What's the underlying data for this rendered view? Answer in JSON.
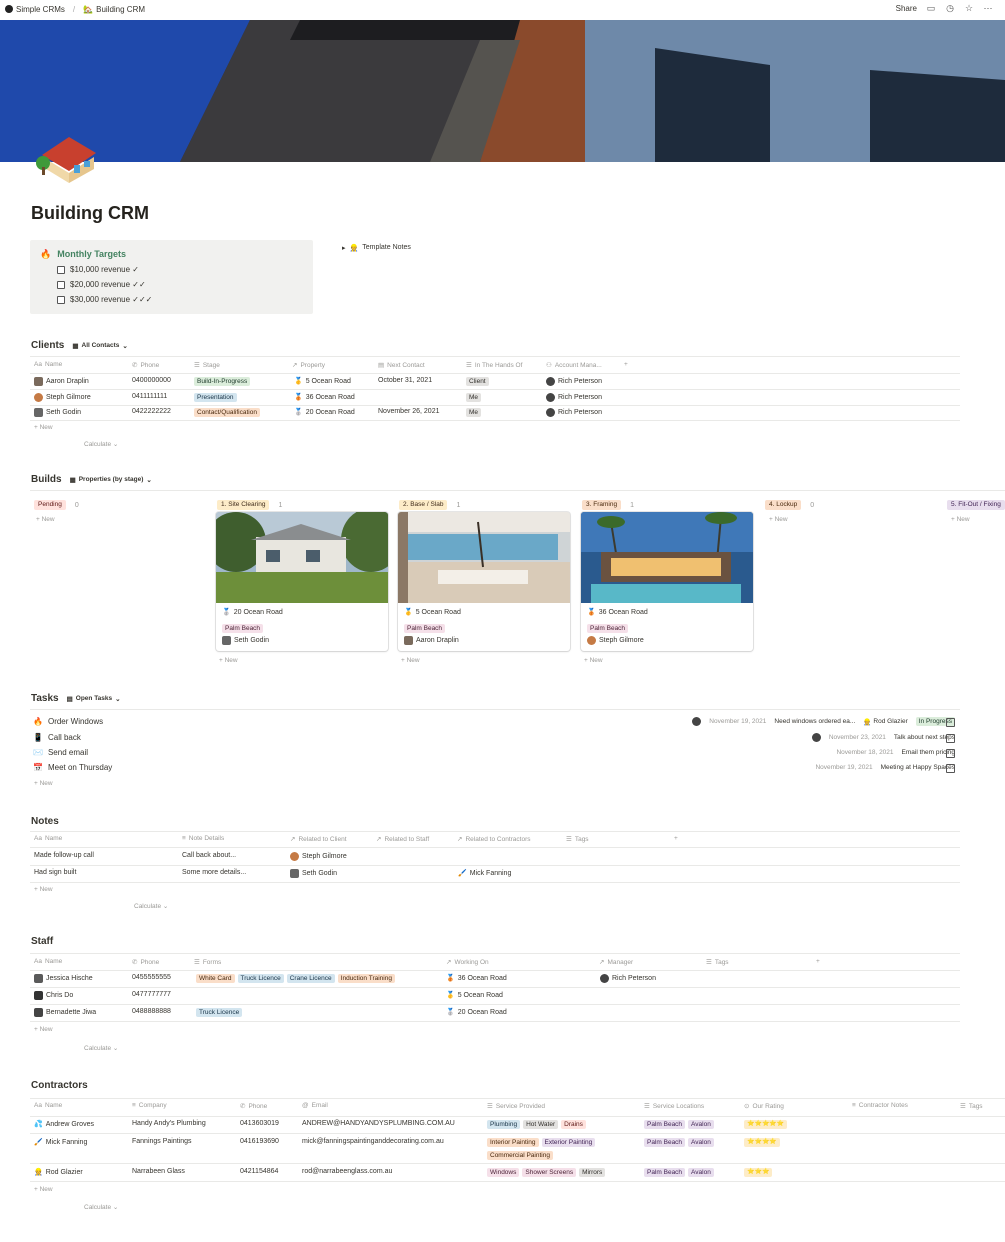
{
  "breadcrumb": {
    "root": "Simple CRMs",
    "page": "Building CRM"
  },
  "topbar": {
    "share_label": "Share"
  },
  "page": {
    "title": "Building CRM"
  },
  "callout": {
    "heading": "Monthly Targets",
    "items": [
      "$10,000 revenue ✓",
      "$20,000 revenue ✓✓",
      "$30,000 revenue ✓✓✓"
    ]
  },
  "toggle": {
    "label": "Template Notes"
  },
  "clients": {
    "title": "Clients",
    "view": "All Contacts",
    "headers": [
      "Name",
      "Phone",
      "Stage",
      "Property",
      "Next Contact",
      "In The Hands Of",
      "Account Mana..."
    ],
    "rows": [
      {
        "name": "Aaron Draplin",
        "phone": "0400000000",
        "stage": "Build-In-Progress",
        "property": "5 Ocean Road",
        "next": "October 31, 2021",
        "hands": "Client",
        "manager": "Rich Peterson"
      },
      {
        "name": "Steph Gilmore",
        "phone": "0411111111",
        "stage": "Presentation",
        "property": "36 Ocean Road",
        "next": "",
        "hands": "Me",
        "manager": "Rich Peterson"
      },
      {
        "name": "Seth Godin",
        "phone": "0422222222",
        "stage": "Contact/Qualification",
        "property": "20 Ocean Road",
        "next": "November 26, 2021",
        "hands": "Me",
        "manager": "Rich Peterson"
      }
    ],
    "new_label": "+ New",
    "calc_label": "Calculate ⌄"
  },
  "builds": {
    "title": "Builds",
    "view": "Properties (by stage)",
    "columns": [
      {
        "label": "Pending",
        "count": "0"
      },
      {
        "label": "1. Site Clearing",
        "count": "1"
      },
      {
        "label": "2. Base / Slab",
        "count": "1"
      },
      {
        "label": "3. Framing",
        "count": "1"
      },
      {
        "label": "4. Lockup",
        "count": "0"
      },
      {
        "label": "5. Fit-Out / Fixing",
        "count": ""
      }
    ],
    "cards": [
      {
        "title": "20 Ocean Road",
        "location": "Palm Beach",
        "person": "Seth Godin"
      },
      {
        "title": "5 Ocean Road",
        "location": "Palm Beach",
        "person": "Aaron Draplin"
      },
      {
        "title": "36 Ocean Road",
        "location": "Palm Beach",
        "person": "Steph Gilmore"
      }
    ],
    "new_label": "+ New"
  },
  "tasks": {
    "title": "Tasks",
    "view": "Open Tasks",
    "rows": [
      {
        "name": "Order Windows",
        "date": "November 19, 2021",
        "note": "Need windows ordered ea...",
        "assignee": "Rod Glazier",
        "status": "In Progress"
      },
      {
        "name": "Call back",
        "date": "November 23, 2021",
        "note": "Talk about next steps"
      },
      {
        "name": "Send email",
        "date": "November 18, 2021",
        "note": "Email them pricing"
      },
      {
        "name": "Meet on Thursday",
        "date": "November 19, 2021",
        "note": "Meeting at Happy Spaces"
      }
    ],
    "new_label": "+ New"
  },
  "notes": {
    "title": "Notes",
    "headers": [
      "Name",
      "Note Details",
      "Related to Client",
      "Related to Staff",
      "Related to Contractors",
      "Tags"
    ],
    "rows": [
      {
        "name": "Made follow-up call",
        "details": "Call back about...",
        "client": "Steph Gilmore",
        "contractor": ""
      },
      {
        "name": "Had sign built",
        "details": "Some more details...",
        "client": "Seth Godin",
        "contractor": "Mick Fanning"
      }
    ],
    "new_label": "+ New",
    "calc_label": "Calculate ⌄"
  },
  "staff": {
    "title": "Staff",
    "headers": [
      "Name",
      "Phone",
      "Forms",
      "Working On",
      "Manager",
      "Tags"
    ],
    "rows": [
      {
        "name": "Jessica Hische",
        "phone": "0455555555",
        "forms": [
          "White Card",
          "Truck Licence",
          "Crane Licence",
          "Induction Training"
        ],
        "working": "36 Ocean Road",
        "manager": "Rich Peterson"
      },
      {
        "name": "Chris Do",
        "phone": "0477777777",
        "forms": [],
        "working": "5 Ocean Road",
        "manager": ""
      },
      {
        "name": "Bernadette Jiwa",
        "phone": "0488888888",
        "forms": [
          "Truck Licence"
        ],
        "working": "20 Ocean Road",
        "manager": ""
      }
    ],
    "new_label": "+ New",
    "calc_label": "Calculate ⌄"
  },
  "contractors": {
    "title": "Contractors",
    "headers": [
      "Name",
      "Company",
      "Phone",
      "Email",
      "Service Provided",
      "Service Locations",
      "Our Rating",
      "Contractor Notes",
      "Tags"
    ],
    "rows": [
      {
        "name": "Andrew Groves",
        "company": "Handy Andy's Plumbing",
        "phone": "0413603019",
        "email": "ANDREW@HANDYANDYSPLUMBING.COM.AU",
        "services": [
          "Plumbing",
          "Hot Water",
          "Drains"
        ],
        "locations": [
          "Palm Beach",
          "Avalon"
        ],
        "rating": "⭐⭐⭐⭐⭐"
      },
      {
        "name": "Mick Fanning",
        "company": "Fannings Paintings",
        "phone": "0416193690",
        "email": "mick@fanningspaintinganddecorating.com.au",
        "services": [
          "Interior Painting",
          "Exterior Painting",
          "Commercial Painting"
        ],
        "locations": [
          "Palm Beach",
          "Avalon"
        ],
        "rating": "⭐⭐⭐⭐"
      },
      {
        "name": "Rod Glazier",
        "company": "Narrabeen Glass",
        "phone": "0421154864",
        "email": "rod@narrabeenglass.com.au",
        "services": [
          "Windows",
          "Shower Screens",
          "Mirrors"
        ],
        "locations": [
          "Palm Beach",
          "Avalon"
        ],
        "rating": "⭐⭐⭐"
      }
    ],
    "new_label": "+ New",
    "calc_label": "Calculate ⌄"
  }
}
